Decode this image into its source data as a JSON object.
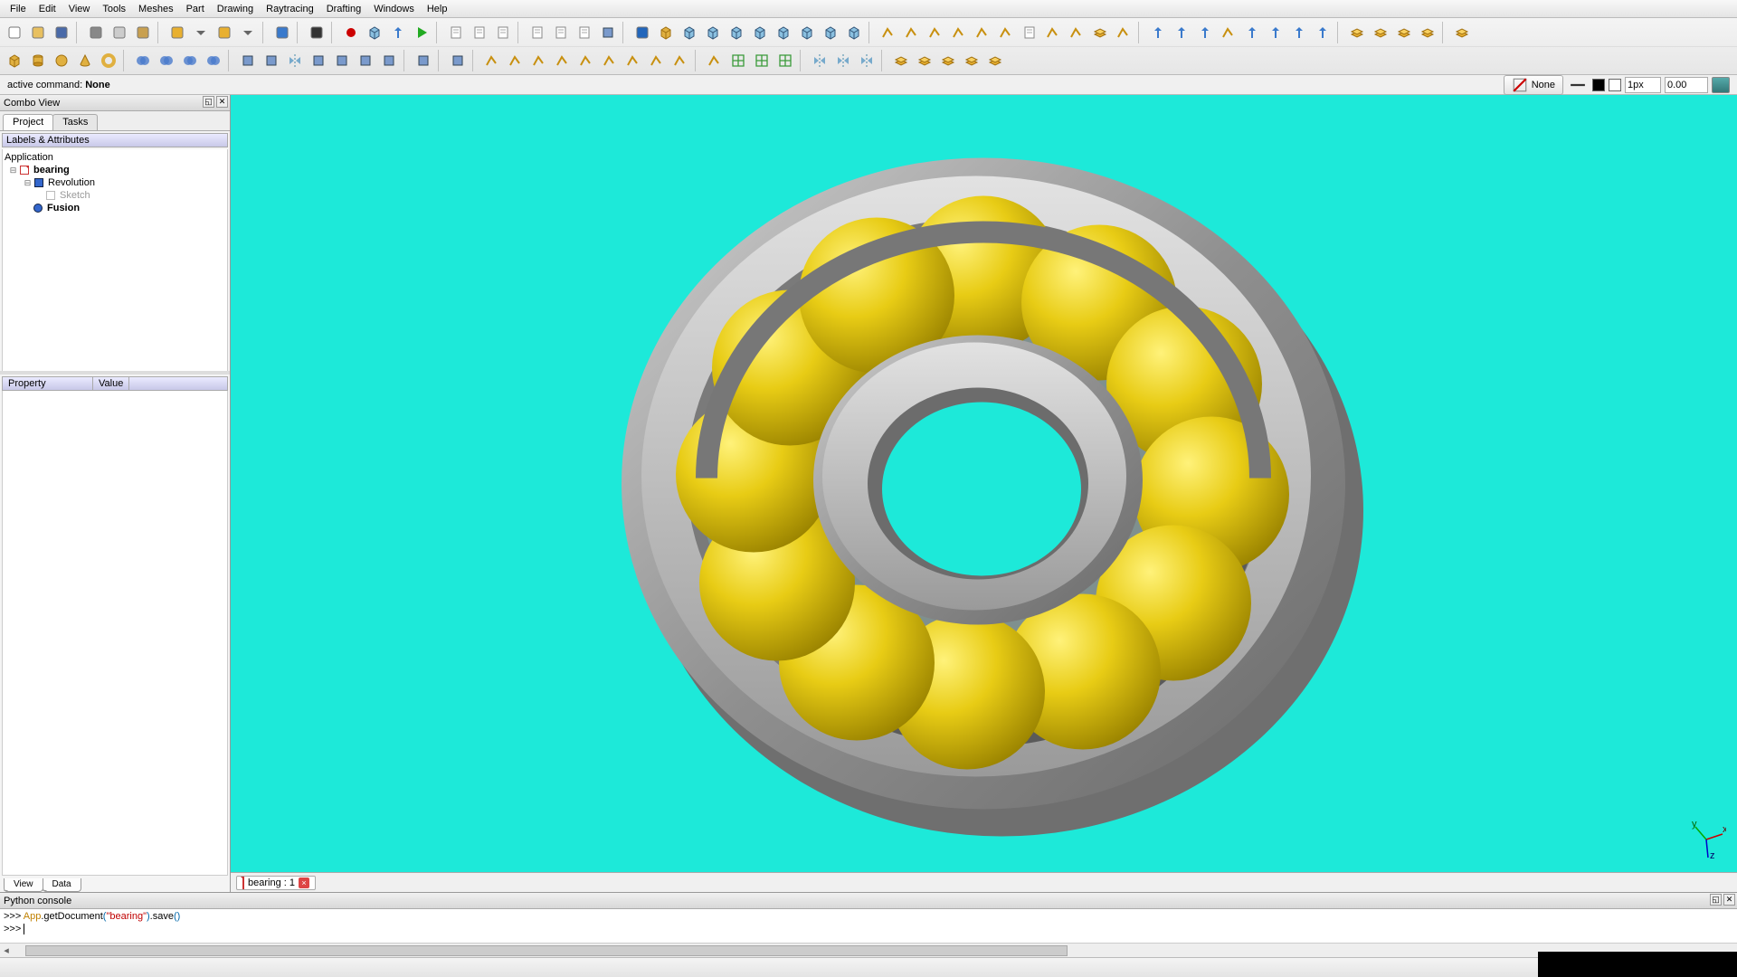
{
  "menu": [
    "File",
    "Edit",
    "View",
    "Tools",
    "Meshes",
    "Part",
    "Drawing",
    "Raytracing",
    "Drafting",
    "Windows",
    "Help"
  ],
  "toolbar_row1_icons": [
    "new-doc-icon",
    "open-icon",
    "save-icon",
    "sep",
    "cut-icon",
    "copy-icon",
    "paste-icon",
    "sep",
    "undo-icon",
    "drop-icon",
    "redo-icon",
    "drop-icon",
    "sep",
    "refresh-icon",
    "sep",
    "whatsthis-icon",
    "sep",
    "record-icon",
    "stop-icon",
    "macro-edit-icon",
    "play-icon",
    "sep",
    "workbench1-icon",
    "workbench2-icon",
    "workbench3-icon",
    "sep",
    "page-icon",
    "page-a3-icon",
    "page-view-icon",
    "export-page-icon",
    "sep",
    "zoom-fit-icon",
    "box-icon",
    "axo-icon",
    "front-icon",
    "right-icon",
    "top-icon",
    "back-icon",
    "left-icon",
    "bottom-icon",
    "iso2-icon",
    "sep",
    "line-icon",
    "polyline-icon",
    "arc-icon",
    "circle-icon",
    "polygon-icon",
    "rect-icon",
    "text-icon",
    "dim-icon",
    "point-icon",
    "shapes-icon",
    "bspline-icon",
    "sep",
    "move-icon",
    "rotate-icon",
    "offset-icon",
    "trim-icon",
    "up-icon",
    "down-icon",
    "scale-icon",
    "edit-icon",
    "sep",
    "clone-icon",
    "array-icon",
    "sketch-draft-icon",
    "draft-sketch-icon",
    "sep",
    "sheet-icon"
  ],
  "toolbar_row2_icons": [
    "cube-icon",
    "cylinder-icon",
    "sphere-icon",
    "cone-icon",
    "torus-icon",
    "sep",
    "fuse-icon",
    "cut-bool-icon",
    "common-icon",
    "section-icon",
    "sep",
    "extrude-icon",
    "revolve-icon",
    "mirror-icon",
    "fillet-icon",
    "chamfer-icon",
    "loft-icon",
    "sweep-icon",
    "sep",
    "inspect-icon",
    "sep",
    "export-icon",
    "sep",
    "s-sketch-icon",
    "s-line-icon",
    "s-circle-icon",
    "s-arc-icon",
    "s-rect-icon",
    "s-fillet-icon",
    "s-trim-icon",
    "s-constr-icon",
    "s-lock-icon",
    "sep",
    "mesh-trim-icon",
    "mesh-seg-icon",
    "mesh-hole-icon",
    "mesh-eval-icon",
    "sep",
    "mirror-v-icon",
    "flip-h-icon",
    "flip-v-icon",
    "sep",
    "layer-icon",
    "face-icon",
    "shell-icon",
    "solid-icon",
    "comp-icon"
  ],
  "cmd": {
    "label": "active command:",
    "value": "None"
  },
  "style_panel": {
    "none_label": "None",
    "px": "1px",
    "val": "0.00",
    "color": "#000000"
  },
  "combo": {
    "title": "Combo View",
    "tabs": [
      "Project",
      "Tasks"
    ],
    "tree_header": "Labels & Attributes",
    "tree": {
      "root": "Application",
      "doc": "bearing",
      "items": [
        {
          "label": "Revolution",
          "bold": false,
          "icon": "cube"
        },
        {
          "label": "Sketch",
          "bold": false,
          "icon": "sketch",
          "grey": true
        },
        {
          "label": "Fusion",
          "bold": true,
          "icon": "fuse"
        }
      ]
    },
    "prop_cols": [
      "Property",
      "Value"
    ],
    "bottom_tabs": [
      "View",
      "Data"
    ]
  },
  "doc_tab": {
    "label": "bearing : 1"
  },
  "py": {
    "title": "Python console",
    "line": {
      "prefix": ">>> ",
      "p1": "App",
      "p2": ".getDocument",
      "arg": "\"bearing\"",
      "p3": ".save",
      "p4": "()"
    },
    "prompt": ">>> "
  },
  "axis_labels": {
    "x": "x",
    "y": "y",
    "z": "z"
  }
}
